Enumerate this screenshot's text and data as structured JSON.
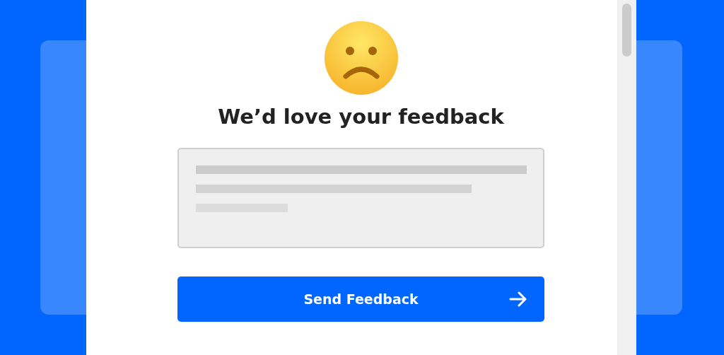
{
  "title": "We’d love your feedback",
  "button": {
    "label": "Send Feedback"
  }
}
